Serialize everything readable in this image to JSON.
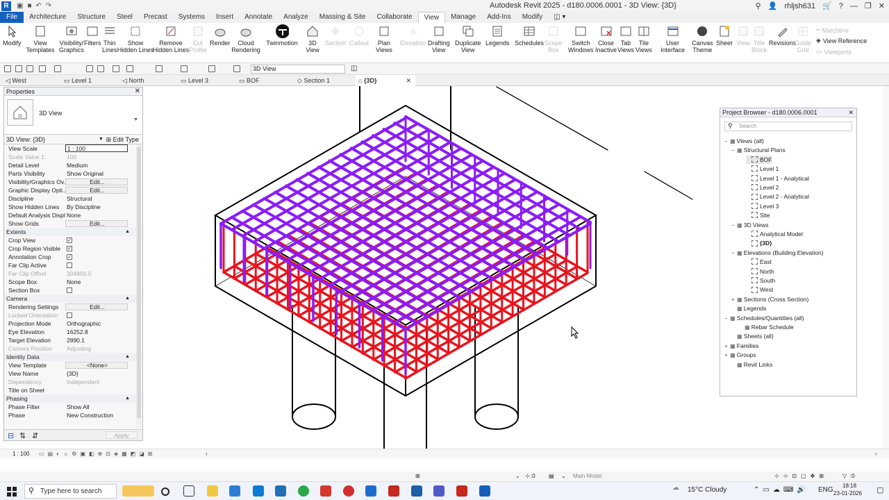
{
  "app": {
    "title": "Autodesk Revit 2025 - d180.0006.0001 - 3D View: {3D}",
    "logo": "R",
    "user": "rhljsh631"
  },
  "ribbon_tabs": [
    "File",
    "Architecture",
    "Structure",
    "Steel",
    "Precast",
    "Systems",
    "Insert",
    "Annotate",
    "Analyze",
    "Massing & Site",
    "Collaborate",
    "View",
    "Manage",
    "Add-Ins",
    "Modify"
  ],
  "active_tab": "View",
  "ribbon": {
    "modify": "Modify",
    "view_templates": "View\nTemplates",
    "visibility_graphics": "Visibility/\nGraphics",
    "filters": "Filters",
    "thin_lines": "Thin\nLines",
    "show_hidden": "Show\nHidden Lines",
    "remove_hidden": "Remove\nHidden Lines",
    "cut_profile": "Cut\nProfile",
    "render": "Render",
    "cloud_rendering": "Cloud\nRendering",
    "twinmotion": "Twinmotion",
    "view_3d": "3D\nView",
    "section": "Section",
    "callout": "Callout",
    "plan_views": "Plan\nViews",
    "elevation": "Elevation",
    "drafting_view": "Drafting\nView",
    "duplicate_view": "Duplicate\nView",
    "legends": "Legends",
    "schedules": "Schedules",
    "scope_box": "Scope\nBox",
    "switch_windows": "Switch\nWindows",
    "close_inactive": "Close\nInactive",
    "tab_views": "Tab\nViews",
    "tile_views": "Tile\nViews",
    "user_interface": "User\nInterface",
    "canvas_theme": "Canvas\nTheme",
    "sheet": "Sheet",
    "view": "View",
    "title_block": "Title\nBlock",
    "revisions": "Revisions",
    "guide_grid": "Guide\nGrid",
    "matchline": "Matchline",
    "view_reference": "View Reference",
    "viewports": "Viewports"
  },
  "view_combo": "3D View",
  "doc_tabs": [
    "West",
    "Level 1",
    "North",
    "Level 3",
    "BOF",
    "Section 1",
    "{3D}"
  ],
  "properties": {
    "title": "Properties",
    "type_name": "3D View",
    "filter": "3D View: {3D}",
    "edit_type": "Edit Type",
    "rows_graphics": [
      {
        "k": "View Scale",
        "v": "1 : 100"
      },
      {
        "k": "Scale Value    1:",
        "v": "100"
      },
      {
        "k": "Detail Level",
        "v": "Medium"
      },
      {
        "k": "Parts Visibility",
        "v": "Show Original"
      },
      {
        "k": "Visibility/Graphics Ov...",
        "v": "Edit..."
      },
      {
        "k": "Graphic Display Opti...",
        "v": "Edit..."
      },
      {
        "k": "Discipline",
        "v": "Structural"
      },
      {
        "k": "Show Hidden Lines",
        "v": "By Discipline"
      },
      {
        "k": "Default Analysis Displ...",
        "v": "None"
      },
      {
        "k": "Show Grids",
        "v": "Edit..."
      }
    ],
    "sec_extents": "Extents",
    "rows_extents": [
      {
        "k": "Crop View",
        "v": "✓"
      },
      {
        "k": "Crop Region Visible",
        "v": "✓"
      },
      {
        "k": "Annotation Crop",
        "v": "✓"
      },
      {
        "k": "Far Clip Active",
        "v": ""
      },
      {
        "k": "Far Clip Offset",
        "v": "304800.0"
      },
      {
        "k": "Scope Box",
        "v": "None"
      },
      {
        "k": "Section Box",
        "v": ""
      }
    ],
    "sec_camera": "Camera",
    "rows_camera": [
      {
        "k": "Rendering Settings",
        "v": "Edit..."
      },
      {
        "k": "Locked Orientation",
        "v": ""
      },
      {
        "k": "Projection Mode",
        "v": "Orthographic"
      },
      {
        "k": "Eye Elevation",
        "v": "16252.8"
      },
      {
        "k": "Target Elevation",
        "v": "2890.1"
      },
      {
        "k": "Camera Position",
        "v": "Adjusting"
      }
    ],
    "sec_identity": "Identity Data",
    "rows_identity": [
      {
        "k": "View Template",
        "v": "<None>"
      },
      {
        "k": "View Name",
        "v": "{3D}"
      },
      {
        "k": "Dependency",
        "v": "Independent"
      },
      {
        "k": "Title on Sheet",
        "v": ""
      }
    ],
    "sec_phasing": "Phasing",
    "rows_phasing": [
      {
        "k": "Phase Filter",
        "v": "Show All"
      },
      {
        "k": "Phase",
        "v": "New Construction"
      }
    ],
    "apply": "Apply"
  },
  "browser": {
    "title": "Project Browser - d180.0006.0001",
    "search": "Search",
    "items": [
      "Views (all)",
      "Structural Plans",
      "BOF",
      "Level 1",
      "Level 1 - Analytical",
      "Level 2",
      "Level 2 - Analytical",
      "Level 3",
      "Site",
      "3D Views",
      "Analytical Model",
      "{3D}",
      "Elevations (Building Elevation)",
      "East",
      "North",
      "South",
      "West",
      "Sections (Cross Section)",
      "Legends",
      "Schedules/Quantities (all)",
      "Rebar Schedule",
      "Sheets (all)",
      "Families",
      "Groups",
      "Revit Links"
    ]
  },
  "status": {
    "scale": "1 : 100",
    "zero1": ":0",
    "model": "Main Model",
    "zero2": ":0"
  },
  "taskbar": {
    "search": "Type here to search",
    "weather": "15°C  Cloudy",
    "lang": "ENG",
    "time": "18:18",
    "date": "23-01-2026"
  },
  "colors": {
    "rebar_top": "#8b1cf7",
    "rebar_bottom": "#e8141e",
    "accent": "#1560bd"
  }
}
